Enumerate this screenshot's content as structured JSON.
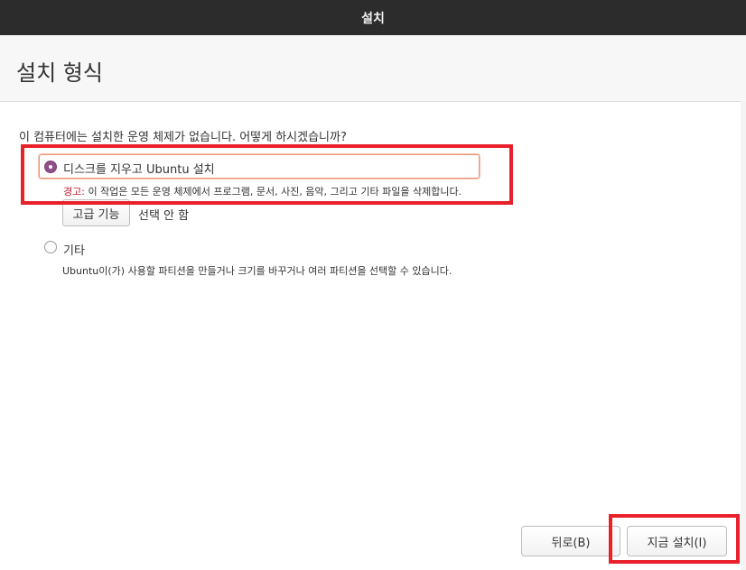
{
  "window": {
    "title": "설치"
  },
  "page": {
    "title": "설치 형식"
  },
  "question": "이 컴퓨터에는 설치한 운영 체제가 없습니다. 어떻게 하시겠습니까?",
  "options": [
    {
      "label": "디스크를 지우고 Ubuntu 설치",
      "selected": true,
      "warning_prefix": "경고:",
      "warning_text": " 이 작업은 모든 운영 체제에서 프로그램, 문서, 사진, 음악, 그리고 기타 파일을 삭제합니다.",
      "advanced_button": "고급 기능",
      "advanced_status": "선택 안 함"
    },
    {
      "label": "기타",
      "selected": false,
      "description": "Ubuntu이(가) 사용할 파티션을 만들거나 크기를 바꾸거나 여러 파티션을 선택할 수 있습니다."
    }
  ],
  "buttons": {
    "back": "뒤로(B)",
    "install_now": "지금 설치(I)"
  },
  "colors": {
    "titlebar": "#2c2c2c",
    "radio_selected": "#924d8b",
    "warning": "#c7162b",
    "highlight": "#e8202a"
  }
}
